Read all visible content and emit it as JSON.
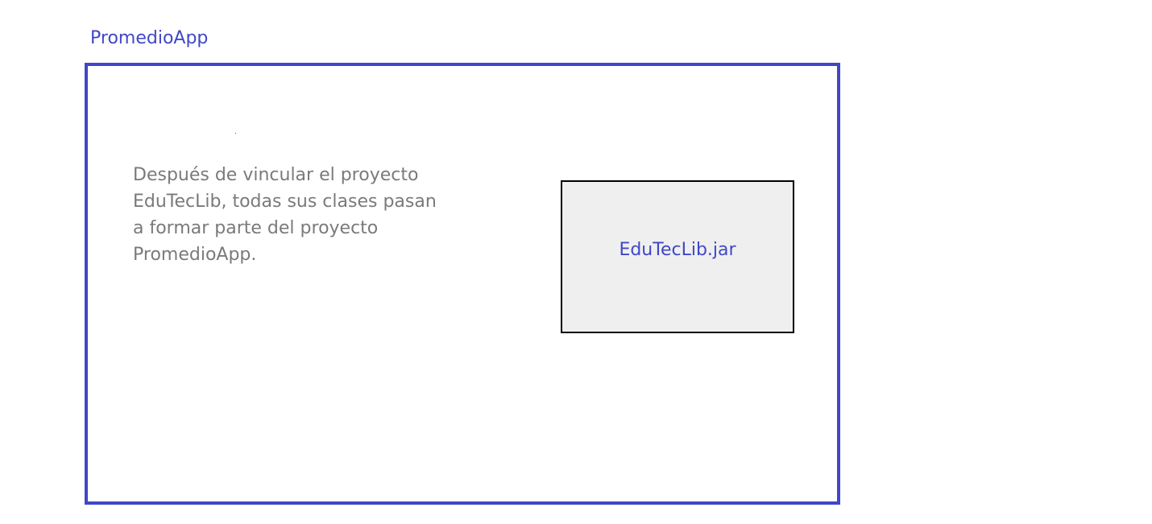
{
  "diagram": {
    "project": {
      "title": "PromedioApp",
      "description": "Después de vincular el proyecto\nEduTecLib, todas sus clases pasan\na formar parte del proyecto\nPromedioApp."
    },
    "library": {
      "label": "EduTecLib.jar"
    },
    "colors": {
      "accent": "#4047c8",
      "text_muted": "#7a7a7a",
      "library_fill": "#efefef",
      "library_border": "#000000"
    }
  }
}
